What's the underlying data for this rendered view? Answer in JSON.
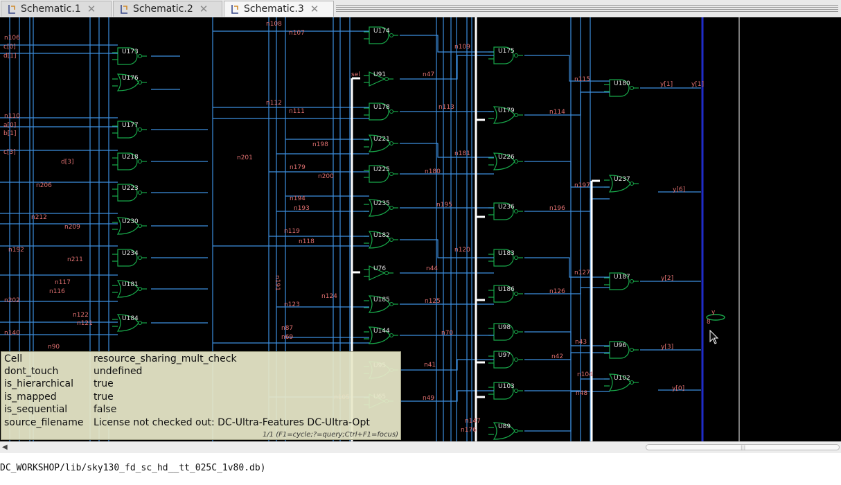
{
  "tabs": [
    {
      "label": "Schematic.1",
      "active": false
    },
    {
      "label": "Schematic.2",
      "active": false
    },
    {
      "label": "Schematic.3",
      "active": true
    }
  ],
  "colors": {
    "canvas_bg": "#000000",
    "wire": "#3d8fe0",
    "gate": "#18a84a",
    "net_label": "#e07070",
    "bus": "#ffffff",
    "output_bus": "#1f2cc8",
    "tooltip_bg": "#e8e8c9"
  },
  "schematic": {
    "cells": [
      "U174",
      "U173",
      "U176",
      "U175",
      "U91",
      "U180",
      "U177",
      "U178",
      "U179",
      "U221",
      "U218",
      "U226",
      "U225",
      "U223",
      "U237",
      "U235",
      "U236",
      "U230",
      "U182",
      "U234",
      "U183",
      "U76",
      "U181",
      "U186",
      "U187",
      "U185",
      "U184",
      "U144",
      "U98",
      "U96",
      "U97",
      "U95",
      "U103",
      "U102",
      "U65",
      "U89"
    ],
    "nets": [
      "n108",
      "n107",
      "n106",
      "n109",
      "n115",
      "n47",
      "n112",
      "n111",
      "n113",
      "n114",
      "n110",
      "n198",
      "n201",
      "n181",
      "n179",
      "n180",
      "n200",
      "n206",
      "n197",
      "n194",
      "n195",
      "n193",
      "n196",
      "n212",
      "n209",
      "n119",
      "n118",
      "n120",
      "n192",
      "n211",
      "n127",
      "n44",
      "n117",
      "n116",
      "n124",
      "n126",
      "n202",
      "n123",
      "n125",
      "n122",
      "n121",
      "n87",
      "n69",
      "n70",
      "n43",
      "n140",
      "n90",
      "n41",
      "n42",
      "n104",
      "n48",
      "n49",
      "n105",
      "n147",
      "n176",
      "n191"
    ],
    "ports": [
      "sel",
      "c[0]",
      "d[1]",
      "a[0]",
      "b[1]",
      "c[3]",
      "d[3]",
      "y[1]",
      "y[6]",
      "y[2]",
      "y[3]",
      "y[0]",
      "y",
      "8"
    ]
  },
  "tooltip": {
    "rows": [
      {
        "key": "Cell",
        "value": "resource_sharing_mult_check"
      },
      {
        "key": "dont_touch",
        "value": "undefined"
      },
      {
        "key": "is_hierarchical",
        "value": "true"
      },
      {
        "key": "is_mapped",
        "value": "true"
      },
      {
        "key": "is_sequential",
        "value": "false"
      },
      {
        "key": "source_filename",
        "value": "License  not  checked  out:  DC-Ultra-Features  DC-Ultra-Opt"
      }
    ],
    "hint": "1/1  (F1=cycle;?=query;Ctrl+F1=focus)"
  },
  "status": {
    "text": "DC_WORKSHOP/lib/sky130_fd_sc_hd__tt_025C_1v80.db)"
  }
}
